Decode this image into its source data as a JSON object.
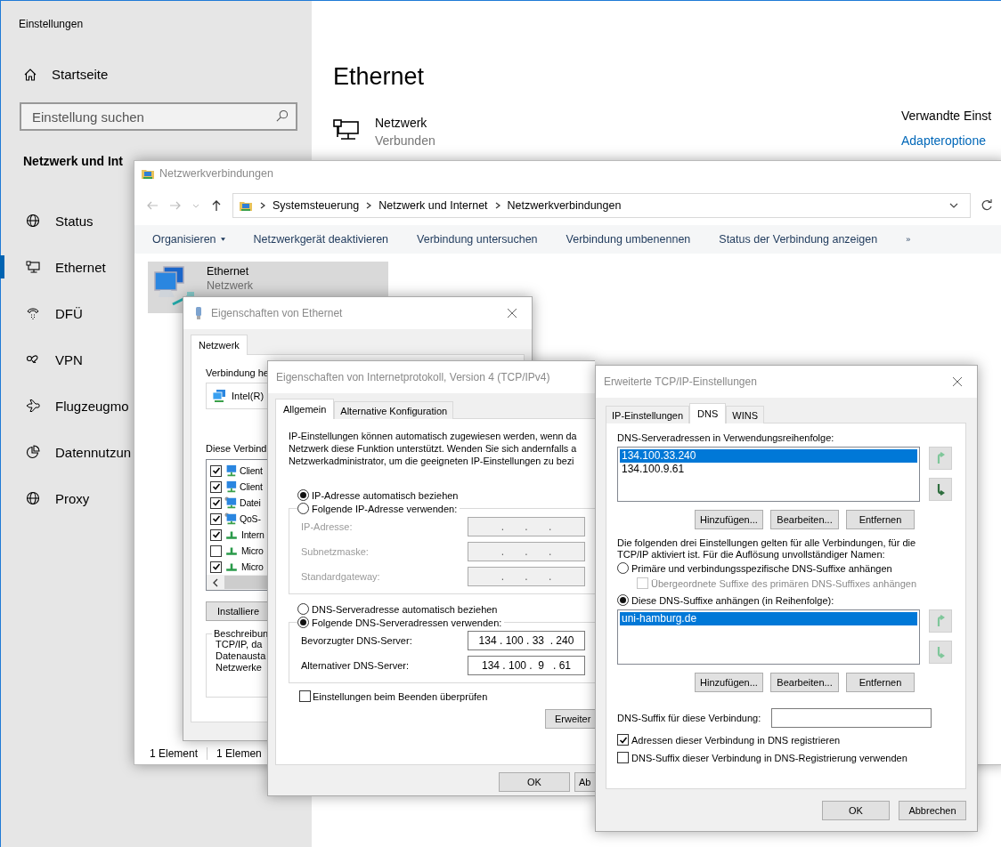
{
  "settings": {
    "title": "Einstellungen",
    "home": "Startseite",
    "search": {
      "placeholder": "Einstellung suchen"
    },
    "section": "Netzwerk und Int",
    "nav": [
      {
        "label": "Status",
        "kind": "globe",
        "selected": false
      },
      {
        "label": "Ethernet",
        "kind": "network",
        "selected": true
      },
      {
        "label": "DFÜ",
        "kind": "phone",
        "selected": false
      },
      {
        "label": "VPN",
        "kind": "link",
        "selected": false
      },
      {
        "label": "Flugzeugmo",
        "kind": "airplane",
        "selected": false
      },
      {
        "label": "Datennutzun",
        "kind": "pie",
        "selected": false
      },
      {
        "label": "Proxy",
        "kind": "globe",
        "selected": false
      }
    ]
  },
  "page": {
    "title": "Ethernet",
    "network": {
      "name": "Netzwerk",
      "status": "Verbunden"
    },
    "related": {
      "heading": "Verwandte Einst",
      "link": "Adapteroptione"
    }
  },
  "explorer": {
    "title": "Netzwerkverbindungen",
    "path": [
      "Systemsteuerung",
      "Netzwerk und Internet",
      "Netzwerkverbindungen"
    ],
    "toolbar": [
      {
        "label": "Organisieren",
        "has_menu": true
      },
      {
        "label": "Netzwerkgerät deaktivieren",
        "has_menu": false
      },
      {
        "label": "Verbindung untersuchen",
        "has_menu": false
      },
      {
        "label": "Verbindung umbenennen",
        "has_menu": false
      },
      {
        "label": "Status der Verbindung anzeigen",
        "has_menu": false
      }
    ],
    "more": "»",
    "item": {
      "name": "Ethernet",
      "type": "Netzwerk",
      "selected": true
    },
    "status": [
      "1 Element",
      "1 Elemen"
    ]
  },
  "ethernet_properties": {
    "title": "Eigenschaften von Ethernet",
    "tabs": [
      {
        "label": "Netzwerk",
        "selected": true
      }
    ],
    "connect_label": "Verbindung he",
    "adapter": "Intel(R)",
    "items_label": "Diese Verbind",
    "items": [
      {
        "label": "Client",
        "checked": true,
        "kind": "client"
      },
      {
        "label": "Client",
        "checked": true,
        "kind": "client"
      },
      {
        "label": "Datei",
        "checked": true,
        "kind": "service"
      },
      {
        "label": "QoS-",
        "checked": true,
        "kind": "service"
      },
      {
        "label": "Intern",
        "checked": true,
        "kind": "protocol"
      },
      {
        "label": "Micro",
        "checked": false,
        "kind": "protocol"
      },
      {
        "label": "Micro",
        "checked": true,
        "kind": "protocol"
      }
    ],
    "install_button": "Installiere",
    "description": {
      "legend": "Beschreibun",
      "lines": [
        "TCP/IP, da",
        "Datenausta",
        "Netzwerke"
      ]
    }
  },
  "ipv4_properties": {
    "title": "Eigenschaften von Internetprotokoll, Version 4 (TCP/IPv4)",
    "tabs": [
      {
        "label": "Allgemein",
        "selected": true
      },
      {
        "label": "Alternative Konfiguration",
        "selected": false
      }
    ],
    "intro": [
      "IP-Einstellungen können automatisch zugewiesen werden, wenn da",
      "Netzwerk diese Funktion unterstützt. Wenden Sie sich andernfalls a",
      "Netzwerkadministrator, um die geeigneten IP-Einstellungen zu bezi"
    ],
    "ip_auto": {
      "label": "IP-Adresse automatisch beziehen",
      "selected": true
    },
    "ip_manual": {
      "label": "Folgende IP-Adresse verwenden:",
      "selected": false
    },
    "ip_fields": [
      {
        "label": "IP-Adresse:",
        "value": ".       .       .",
        "disabled": true
      },
      {
        "label": "Subnetzmaske:",
        "value": ".       .       .",
        "disabled": true
      },
      {
        "label": "Standardgateway:",
        "value": ".       .       .",
        "disabled": true
      }
    ],
    "dns_auto": {
      "label": "DNS-Serveradresse automatisch beziehen",
      "selected": false
    },
    "dns_manual": {
      "label": "Folgende DNS-Serveradressen verwenden:",
      "selected": true
    },
    "dns_fields": [
      {
        "label": "Bevorzugter DNS-Server:",
        "value": "134 . 100 . 33  . 240",
        "disabled": false
      },
      {
        "label": "Alternativer DNS-Server:",
        "value": "134 . 100 .  9   . 61",
        "disabled": false
      }
    ],
    "validate": {
      "label": "Einstellungen beim Beenden überprüfen",
      "checked": false
    },
    "advanced_button": "Erweiter",
    "buttons": [
      "OK",
      "Ab"
    ]
  },
  "advanced_tcpip": {
    "title": "Erweiterte TCP/IP-Einstellungen",
    "tabs": [
      {
        "label": "IP-Einstellungen",
        "selected": false
      },
      {
        "label": "DNS",
        "selected": true
      },
      {
        "label": "WINS",
        "selected": false
      }
    ],
    "servers_label": "DNS-Serveradressen in Verwendungsreihenfolge:",
    "servers": [
      {
        "address": "134.100.33.240",
        "selected": true
      },
      {
        "address": "134.100.9.61",
        "selected": false
      }
    ],
    "servers_move": [
      {
        "kind": "up",
        "disabled": true
      },
      {
        "kind": "down",
        "disabled": false
      }
    ],
    "servers_buttons": [
      "Hinzufügen...",
      "Bearbeiten...",
      "Entfernen"
    ],
    "info": "Die folgenden drei Einstellungen gelten für alle Verbindungen, für die TCP/IP aktiviert ist. Für die Auflösung unvollständiger Namen:",
    "primary_suffix": {
      "label": "Primäre und verbindungsspezifische DNS-Suffixe anhängen",
      "selected": false
    },
    "parent_suffix": {
      "label": "Übergeordnete Suffixe des primären DNS-Suffixes anhängen",
      "checked": false,
      "disabled": true
    },
    "these_suffixes": {
      "label": "Diese DNS-Suffixe anhängen (in Reihenfolge):",
      "selected": true
    },
    "suffixes": [
      {
        "name": "uni-hamburg.de",
        "selected": true
      }
    ],
    "suffixes_move": [
      {
        "kind": "up",
        "disabled": true
      },
      {
        "kind": "down",
        "disabled": true
      }
    ],
    "suffixes_buttons": [
      "Hinzufügen...",
      "Bearbeiten...",
      "Entfernen"
    ],
    "connection_suffix": {
      "label": "DNS-Suffix für diese Verbindung:"
    },
    "register": [
      {
        "label": "Adressen dieser Verbindung in DNS registrieren",
        "checked": true
      },
      {
        "label": "DNS-Suffix dieser Verbindung in DNS-Registrierung verwenden",
        "checked": false
      }
    ],
    "buttons": [
      "OK",
      "Abbrechen"
    ]
  }
}
